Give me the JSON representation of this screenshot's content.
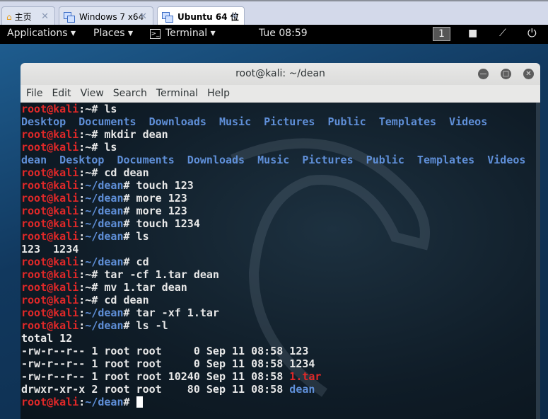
{
  "tabs": [
    {
      "label": "主页",
      "icon": "home-icon"
    },
    {
      "label": "Windows 7 x64",
      "icon": "vm-icon"
    },
    {
      "label": "Ubuntu 64 位",
      "icon": "vm-running-icon"
    }
  ],
  "topbar": {
    "applications": "Applications ▾",
    "places": "Places ▾",
    "terminal": "Terminal ▾",
    "clock": "Tue 08:59",
    "workspace": "1"
  },
  "window": {
    "title": "root@kali: ~/dean",
    "menu": [
      "File",
      "Edit",
      "View",
      "Search",
      "Terminal",
      "Help"
    ]
  },
  "terminal": {
    "lines": [
      [
        [
          "r",
          "root@kali"
        ],
        [
          "w",
          ":~# ls"
        ]
      ],
      [
        [
          "b",
          "Desktop  Documents  Downloads  Music  Pictures  Public  Templates  Videos"
        ]
      ],
      [
        [
          "r",
          "root@kali"
        ],
        [
          "w",
          ":~# mkdir dean"
        ]
      ],
      [
        [
          "r",
          "root@kali"
        ],
        [
          "w",
          ":~# ls"
        ]
      ],
      [
        [
          "b",
          "dean  Desktop  Documents  Downloads  Music  Pictures  Public  Templates  Videos"
        ]
      ],
      [
        [
          "r",
          "root@kali"
        ],
        [
          "w",
          ":~# cd dean"
        ]
      ],
      [
        [
          "r",
          "root@kali"
        ],
        [
          "w",
          ":"
        ],
        [
          "b",
          "~/dean"
        ],
        [
          "w",
          "# touch 123"
        ]
      ],
      [
        [
          "r",
          "root@kali"
        ],
        [
          "w",
          ":"
        ],
        [
          "b",
          "~/dean"
        ],
        [
          "w",
          "# more 123"
        ]
      ],
      [
        [
          "r",
          "root@kali"
        ],
        [
          "w",
          ":"
        ],
        [
          "b",
          "~/dean"
        ],
        [
          "w",
          "# more 123"
        ]
      ],
      [
        [
          "r",
          "root@kali"
        ],
        [
          "w",
          ":"
        ],
        [
          "b",
          "~/dean"
        ],
        [
          "w",
          "# touch 1234"
        ]
      ],
      [
        [
          "r",
          "root@kali"
        ],
        [
          "w",
          ":"
        ],
        [
          "b",
          "~/dean"
        ],
        [
          "w",
          "# ls"
        ]
      ],
      [
        [
          "w",
          "123  1234"
        ]
      ],
      [
        [
          "r",
          "root@kali"
        ],
        [
          "w",
          ":"
        ],
        [
          "b",
          "~/dean"
        ],
        [
          "w",
          "# cd"
        ]
      ],
      [
        [
          "r",
          "root@kali"
        ],
        [
          "w",
          ":~# tar -cf 1.tar dean"
        ]
      ],
      [
        [
          "r",
          "root@kali"
        ],
        [
          "w",
          ":~# mv 1.tar dean"
        ]
      ],
      [
        [
          "r",
          "root@kali"
        ],
        [
          "w",
          ":~# cd dean"
        ]
      ],
      [
        [
          "r",
          "root@kali"
        ],
        [
          "w",
          ":"
        ],
        [
          "b",
          "~/dean"
        ],
        [
          "w",
          "# tar -xf 1.tar"
        ]
      ],
      [
        [
          "r",
          "root@kali"
        ],
        [
          "w",
          ":"
        ],
        [
          "b",
          "~/dean"
        ],
        [
          "w",
          "# ls -l"
        ]
      ],
      [
        [
          "w",
          "total 12"
        ]
      ],
      [
        [
          "w",
          "-rw-r--r-- 1 root root     0 Sep 11 08:58 123"
        ]
      ],
      [
        [
          "w",
          "-rw-r--r-- 1 root root     0 Sep 11 08:58 1234"
        ]
      ],
      [
        [
          "w",
          "-rw-r--r-- 1 root root 10240 Sep 11 08:58 "
        ],
        [
          "r",
          "1.tar"
        ]
      ],
      [
        [
          "w",
          "drwxr-xr-x 2 root root    80 Sep 11 08:58 "
        ],
        [
          "b",
          "dean"
        ]
      ],
      [
        [
          "r",
          "root@kali"
        ],
        [
          "w",
          ":"
        ],
        [
          "b",
          "~/dean"
        ],
        [
          "w",
          "# "
        ]
      ]
    ]
  }
}
